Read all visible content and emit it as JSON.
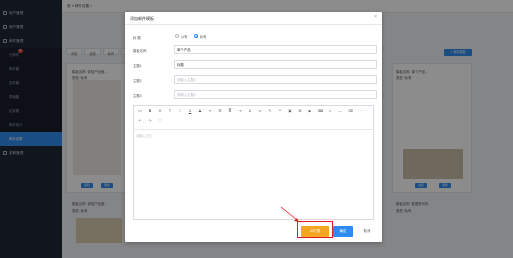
{
  "sidebar": {
    "items": [
      {
        "label": "用户管理",
        "type": "group"
      },
      {
        "label": "商户管理",
        "type": "group"
      },
      {
        "label": "邮件管理",
        "type": "group"
      },
      {
        "label": "已邮件",
        "type": "sub",
        "badge": "5"
      },
      {
        "label": "邮件箱",
        "type": "sub"
      },
      {
        "label": "发件箱",
        "type": "sub"
      },
      {
        "label": "草稿箱",
        "type": "sub"
      },
      {
        "label": "垃圾箱",
        "type": "sub"
      },
      {
        "label": "邮件统计",
        "type": "sub"
      },
      {
        "label": "邮件设置",
        "type": "sub",
        "active": true
      }
    ],
    "user_label": "求职管理"
  },
  "topbar": {
    "breadcrumb": "首  ≡ 邮件设置  ×"
  },
  "background": {
    "tabs": [
      "系统",
      "全部",
      "私有",
      "通用"
    ],
    "add_button": "+ 添加模板",
    "card_title_1": "模板名称: 体验产品营...",
    "card_type_1": "类型: 私有",
    "card_title_2": "模板名称: 单个产品...",
    "card_type_2": "类型: 私有",
    "card_title_3": "模板名称: 体验产品营...",
    "card_type_3": "类型: 私有",
    "card_title_4": "模板名称: 数据带代码",
    "card_type_4": "类型: 私有",
    "btn_edit": "编辑",
    "btn_delete": "删除"
  },
  "modal": {
    "title": "添加邮件模板",
    "close_icon": "×",
    "type_label": "标 题",
    "radio_public": "公有",
    "radio_private": "私有",
    "radio_selected": "private",
    "name_label": "模板名称",
    "name_value": "单个产品",
    "subject1_label": "主题1",
    "subject1_value": "标题",
    "subject2_label": "主题2",
    "subject2_placeholder": "请输入主题2",
    "subject3_label": "主题3",
    "subject3_placeholder": "请输入主题3",
    "editor_placeholder": "请输入正文",
    "btn_add_image": "AI扩图",
    "btn_ok": "确定",
    "btn_cancel": "取消",
    "highlight_color": "#e02020",
    "accent_color": "#2e8cf0",
    "add_image_color": "#f5a623"
  }
}
